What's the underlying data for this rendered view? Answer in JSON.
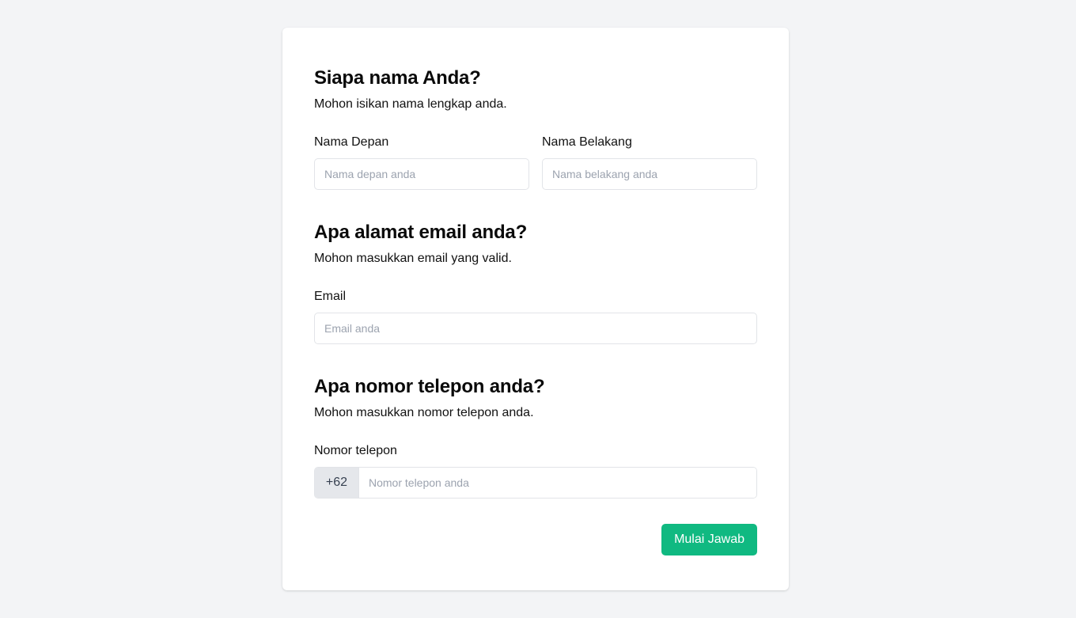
{
  "colors": {
    "page_background": "#f3f4f6",
    "card_background": "#ffffff",
    "accent": "#10b981",
    "input_border": "#e2e4e8",
    "placeholder": "#9ca3af",
    "prefix_background": "#e5e7eb"
  },
  "name_section": {
    "title": "Siapa nama Anda?",
    "description": "Mohon isikan nama lengkap anda.",
    "first_name": {
      "label": "Nama Depan",
      "placeholder": "Nama depan anda",
      "value": ""
    },
    "last_name": {
      "label": "Nama Belakang",
      "placeholder": "Nama belakang anda",
      "value": ""
    }
  },
  "email_section": {
    "title": "Apa alamat email anda?",
    "description": "Mohon masukkan email yang valid.",
    "email": {
      "label": "Email",
      "placeholder": "Email anda",
      "value": ""
    }
  },
  "phone_section": {
    "title": "Apa nomor telepon anda?",
    "description": "Mohon masukkan nomor telepon anda.",
    "phone": {
      "label": "Nomor telepon",
      "prefix": "+62",
      "placeholder": "Nomor telepon anda",
      "value": ""
    }
  },
  "actions": {
    "submit_label": "Mulai Jawab"
  }
}
